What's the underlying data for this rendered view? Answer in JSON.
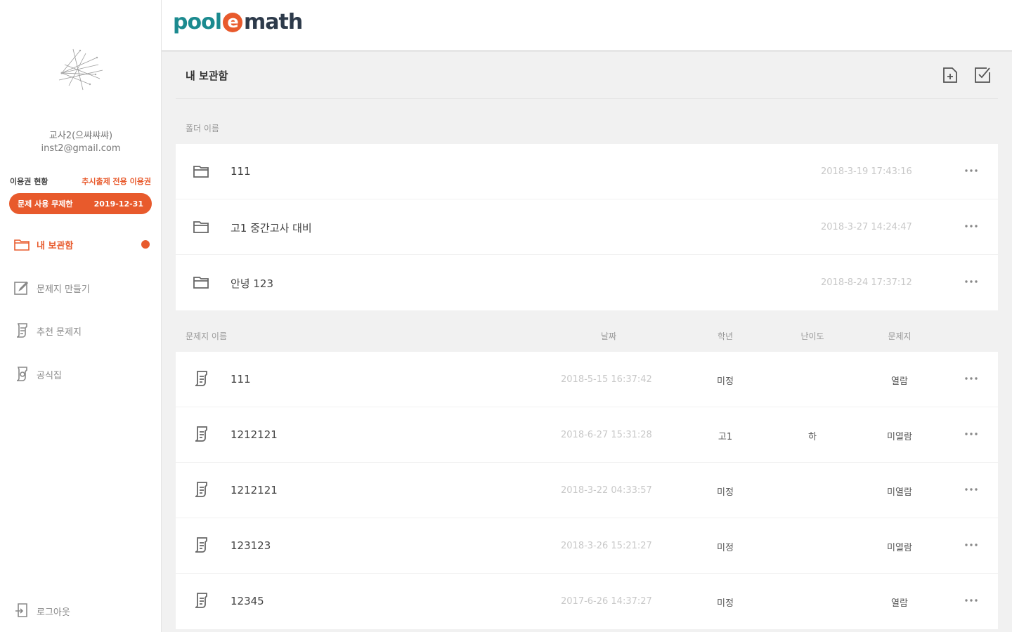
{
  "brand": {
    "part1": "pool",
    "e": "e",
    "part2": "math"
  },
  "user": {
    "name": "교사2(으쌰쌰쌰)",
    "email": "inst2@gmail.com"
  },
  "subscription": {
    "label": "이용권 현황",
    "link": "추시출제 전용 이용권",
    "plan": "문제 사용 무제한",
    "expires": "2019-12-31"
  },
  "nav": [
    {
      "label": "내 보관함",
      "icon": "folder-icon",
      "active": true
    },
    {
      "label": "문제지 만들기",
      "icon": "edit-icon",
      "active": false
    },
    {
      "label": "추천 문제지",
      "icon": "worksheet-icon",
      "active": false
    },
    {
      "label": "공식집",
      "icon": "formula-icon",
      "active": false
    }
  ],
  "logout": {
    "label": "로그아웃",
    "icon": "logout-icon"
  },
  "page": {
    "title": "내 보관함",
    "actions": [
      "new-folder-icon",
      "edit-check-icon"
    ]
  },
  "folders": {
    "header": "폴더 이름",
    "items": [
      {
        "name": "111",
        "date": "2018-3-19 17:43:16"
      },
      {
        "name": "고1 중간고사 대비",
        "date": "2018-3-27 14:24:47"
      },
      {
        "name": "안녕 123",
        "date": "2018-8-24 17:37:12"
      }
    ]
  },
  "worksheets": {
    "headers": {
      "name": "문제지 이름",
      "date": "날짜",
      "grade": "학년",
      "level": "난이도",
      "sheet": "문제지"
    },
    "items": [
      {
        "name": "111",
        "date": "2018-5-15 16:37:42",
        "grade": "미정",
        "level": "",
        "sheet": "열람"
      },
      {
        "name": "1212121",
        "date": "2018-6-27 15:31:28",
        "grade": "고1",
        "level": "하",
        "sheet": "미열람"
      },
      {
        "name": "1212121",
        "date": "2018-3-22 04:33:57",
        "grade": "미정",
        "level": "",
        "sheet": "미열람"
      },
      {
        "name": "123123",
        "date": "2018-3-26 15:21:27",
        "grade": "미정",
        "level": "",
        "sheet": "미열람"
      },
      {
        "name": "12345",
        "date": "2017-6-26 14:37:27",
        "grade": "미정",
        "level": "",
        "sheet": "열람"
      }
    ]
  },
  "colors": {
    "accent": "#e85a2c",
    "brand_teal": "#1b8a8f",
    "brand_dark": "#2d3a4a"
  }
}
